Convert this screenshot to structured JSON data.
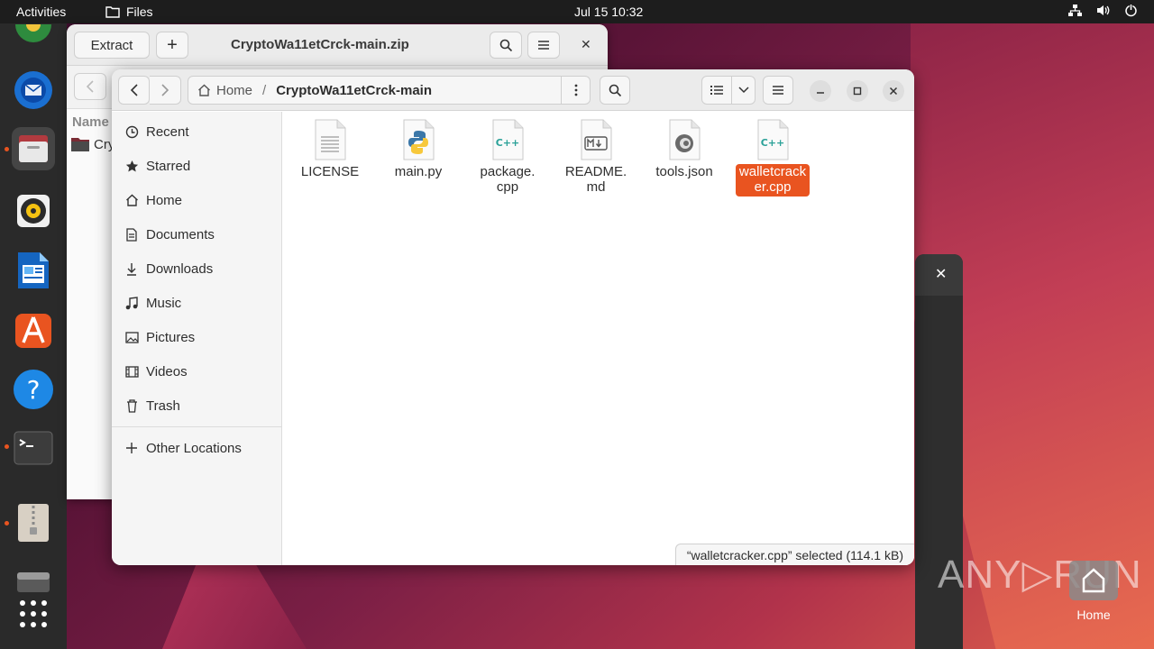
{
  "topbar": {
    "activities": "Activities",
    "app_name": "Files",
    "clock": "Jul 15  10:32",
    "tray_icons": [
      "network-icon",
      "volume-icon",
      "power-icon"
    ]
  },
  "dock": {
    "items": [
      "chrome-icon",
      "thunderbird-icon",
      "files-icon",
      "rhythmbox-icon",
      "writer-icon",
      "app-center-icon",
      "help-icon",
      "terminal-icon",
      "archive-manager-icon",
      "drive-icon",
      "show-apps-icon"
    ]
  },
  "archive_window": {
    "extract_label": "Extract",
    "add_label": "+",
    "title": "CryptoWa11etCrck-main.zip",
    "column_name": "Name",
    "row_name": "Cry"
  },
  "files_window": {
    "path_home": "Home",
    "path_current": "CryptoWa11etCrck-main",
    "sidebar": {
      "items": [
        {
          "label": "Recent",
          "icon": "clock-icon"
        },
        {
          "label": "Starred",
          "icon": "star-icon"
        },
        {
          "label": "Home",
          "icon": "home-icon"
        },
        {
          "label": "Documents",
          "icon": "documents-icon"
        },
        {
          "label": "Downloads",
          "icon": "downloads-icon"
        },
        {
          "label": "Music",
          "icon": "music-icon"
        },
        {
          "label": "Pictures",
          "icon": "pictures-icon"
        },
        {
          "label": "Videos",
          "icon": "videos-icon"
        },
        {
          "label": "Trash",
          "icon": "trash-icon"
        }
      ],
      "other_locations": "Other Locations"
    },
    "files": [
      {
        "name": "LICENSE",
        "type": "text"
      },
      {
        "name": "main.py",
        "type": "python"
      },
      {
        "name": "package.\ncpp",
        "type": "cpp"
      },
      {
        "name": "README.\nmd",
        "type": "markdown"
      },
      {
        "name": "tools.json",
        "type": "json"
      },
      {
        "name": "walletcrack\ner.cpp",
        "type": "cpp",
        "selected": true
      }
    ],
    "status": "“walletcracker.cpp” selected  (114.1 kB)"
  },
  "desktop": {
    "home_label": "Home",
    "watermark": "ANY▷RUN"
  },
  "colors": {
    "accent": "#e95420"
  }
}
